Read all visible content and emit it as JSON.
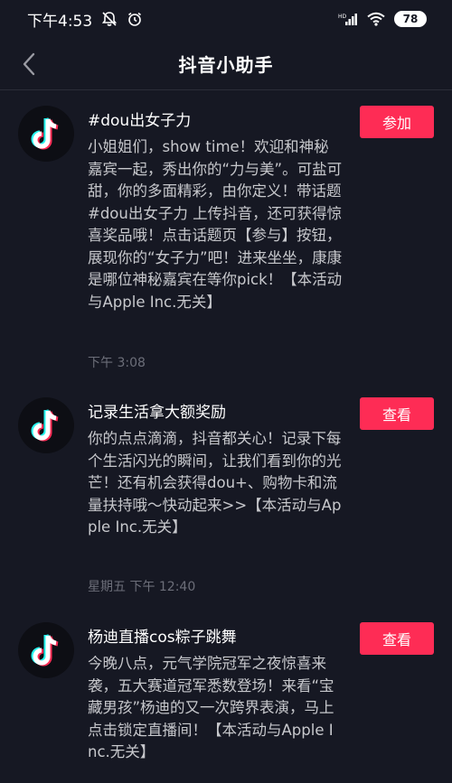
{
  "status_bar": {
    "time": "下午4:53",
    "signal_label": "HD",
    "battery": "78"
  },
  "nav": {
    "title": "抖音小助手"
  },
  "colors": {
    "background": "#161823",
    "accent": "#fe2c55",
    "body_text": "#c7c8cc",
    "muted_text": "#6c6e79"
  },
  "messages": [
    {
      "title": "#dou出女子力",
      "body": "小姐姐们，show time！欢迎和神秘嘉宾一起，秀出你的“力与美”。可盐可甜，你的多面精彩，由你定义！带话题#dou出女子力 上传抖音，还可获得惊喜奖品哦！点击话题页【参与】按钮，展现你的“女子力”吧！进来坐坐，康康是哪位神秘嘉宾在等你pick！【本活动与Apple Inc.无关】",
      "time": "下午 3:08",
      "action": "参加"
    },
    {
      "title": "记录生活拿大额奖励",
      "body": "你的点点滴滴，抖音都关心！记录下每个生活闪光的瞬间，让我们看到你的光芒！还有机会获得dou+、购物卡和流量扶持哦～快动起来>>【本活动与Apple Inc.无关】",
      "time": "星期五 下午 12:40",
      "action": "查看"
    },
    {
      "title": "杨迪直播cos粽子跳舞",
      "body": "今晚八点，元气学院冠军之夜惊喜来袭，五大赛道冠军悉数登场！来看“宝藏男孩”杨迪的又一次跨界表演，马上点击锁定直播间！【本活动与Apple Inc.无关】",
      "time": "",
      "action": "查看"
    }
  ]
}
